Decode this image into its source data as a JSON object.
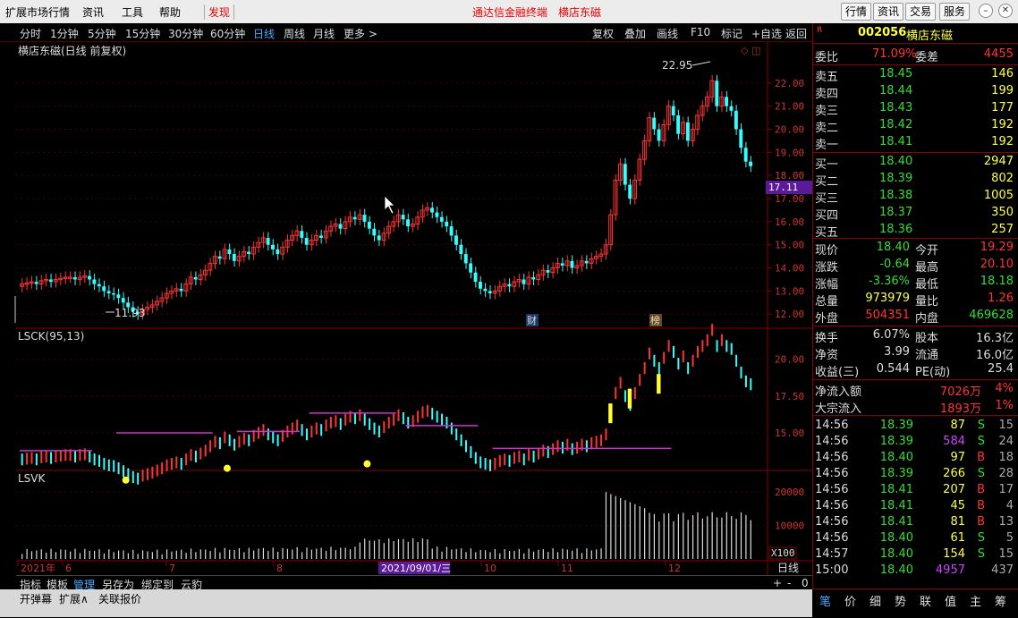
{
  "menu": {
    "items": [
      "扩展市场行情",
      "资讯",
      "工具",
      "帮助"
    ],
    "discover": "发现",
    "title": "通达信金融终端",
    "stock_title": "横店东磁",
    "right_buttons": [
      "行情",
      "资讯",
      "交易",
      "服务"
    ]
  },
  "toolbar": {
    "periods": [
      "分时",
      "1分钟",
      "5分钟",
      "15分钟",
      "30分钟",
      "60分钟",
      "日线",
      "周线",
      "月线",
      "更多 >"
    ],
    "active": "日线",
    "actions": [
      "复权",
      "叠加",
      "画线",
      "F10",
      "标记",
      "+自选",
      "返回"
    ]
  },
  "main_chart": {
    "title": "横店东磁(日线 前复权)",
    "price_label": "17.11",
    "high_label": "22.95",
    "low_label": "11.93",
    "y_ticks": [
      "22.00",
      "21.00",
      "20.00",
      "19.00",
      "18.00",
      "17.00",
      "16.00",
      "15.00",
      "14.00",
      "13.00",
      "12.00"
    ],
    "badges": [
      "财",
      "榜"
    ]
  },
  "lsck": {
    "title": "LSCK(95,13)",
    "y_ticks": [
      "20.00",
      "17.50",
      "15.00"
    ]
  },
  "lsvk": {
    "title": "LSVK",
    "y_ticks": [
      "20000",
      "10000"
    ],
    "unit": "X100"
  },
  "date_axis": {
    "labels": [
      "2021年",
      "6",
      "7",
      "8",
      "2021/09/01/三",
      "10",
      "11",
      "12"
    ],
    "period": "日线"
  },
  "indicator_tabs": [
    "指标",
    "模板",
    "管理",
    "另存为",
    "绑定到",
    "云豹"
  ],
  "bottom_tabs": [
    "开弹幕",
    "扩展∧",
    "关联报价"
  ],
  "quote": {
    "code": "002056",
    "name": "横店东磁",
    "weibi_label": "委比",
    "weibi": "71.09%",
    "weicha_label": "委差",
    "weicha": "4455",
    "asks": [
      {
        "l": "卖五",
        "p": "18.45",
        "v": "146"
      },
      {
        "l": "卖四",
        "p": "18.44",
        "v": "199"
      },
      {
        "l": "卖三",
        "p": "18.43",
        "v": "177"
      },
      {
        "l": "卖二",
        "p": "18.42",
        "v": "192"
      },
      {
        "l": "卖一",
        "p": "18.41",
        "v": "192"
      }
    ],
    "bids": [
      {
        "l": "买一",
        "p": "18.40",
        "v": "2947"
      },
      {
        "l": "买二",
        "p": "18.39",
        "v": "802"
      },
      {
        "l": "买三",
        "p": "18.38",
        "v": "1005"
      },
      {
        "l": "买四",
        "p": "18.37",
        "v": "350"
      },
      {
        "l": "买五",
        "p": "18.36",
        "v": "257"
      }
    ],
    "stats": [
      {
        "a": "现价",
        "av": "18.40",
        "ac": "#33dd33",
        "b": "今开",
        "bv": "19.29",
        "bc": "#ff3333"
      },
      {
        "a": "涨跌",
        "av": "-0.64",
        "ac": "#33dd33",
        "b": "最高",
        "bv": "20.10",
        "bc": "#ff3333"
      },
      {
        "a": "涨幅",
        "av": "-3.36%",
        "ac": "#33dd33",
        "b": "最低",
        "bv": "18.18",
        "bc": "#33dd33"
      },
      {
        "a": "总量",
        "av": "973979",
        "ac": "#ffff44",
        "b": "量比",
        "bv": "1.26",
        "bc": "#ff3333"
      },
      {
        "a": "外盘",
        "av": "504351",
        "ac": "#ff3333",
        "b": "内盘",
        "bv": "469628",
        "bc": "#33dd33"
      }
    ],
    "stats2": [
      {
        "a": "换手",
        "av": "6.07%",
        "b": "股本",
        "bv": "16.3亿"
      },
      {
        "a": "净资",
        "av": "3.99",
        "b": "流通",
        "bv": "16.0亿"
      },
      {
        "a": "收益(三)",
        "av": "0.544",
        "b": "PE(动)",
        "bv": "25.4"
      }
    ],
    "flow": [
      {
        "l": "净流入额",
        "v": "7026万",
        "p": "4%"
      },
      {
        "l": "大宗流入",
        "v": "1893万",
        "p": "1%"
      }
    ],
    "ticks": [
      {
        "t": "14:56",
        "p": "18.39",
        "pc": "#33dd33",
        "v": "87",
        "vc": "#ffff44",
        "s": "S",
        "n": "15"
      },
      {
        "t": "14:56",
        "p": "18.39",
        "pc": "#33dd33",
        "v": "584",
        "vc": "#cc44ff",
        "s": "S",
        "n": "24"
      },
      {
        "t": "14:56",
        "p": "18.40",
        "pc": "#33dd33",
        "v": "97",
        "vc": "#ffff44",
        "s": "B",
        "n": "18"
      },
      {
        "t": "14:56",
        "p": "18.39",
        "pc": "#33dd33",
        "v": "266",
        "vc": "#ffff44",
        "s": "S",
        "n": "28"
      },
      {
        "t": "14:56",
        "p": "18.41",
        "pc": "#33dd33",
        "v": "207",
        "vc": "#ffff44",
        "s": "B",
        "n": "17"
      },
      {
        "t": "14:56",
        "p": "18.41",
        "pc": "#33dd33",
        "v": "45",
        "vc": "#ffff44",
        "s": "B",
        "n": "4"
      },
      {
        "t": "14:56",
        "p": "18.41",
        "pc": "#33dd33",
        "v": "81",
        "vc": "#ffff44",
        "s": "B",
        "n": "13"
      },
      {
        "t": "14:56",
        "p": "18.40",
        "pc": "#33dd33",
        "v": "61",
        "vc": "#ffff44",
        "s": "S",
        "n": "5"
      },
      {
        "t": "14:57",
        "p": "18.40",
        "pc": "#33dd33",
        "v": "154",
        "vc": "#ffff44",
        "s": "S",
        "n": "15"
      },
      {
        "t": "15:00",
        "p": "18.40",
        "pc": "#33dd33",
        "v": "4957",
        "vc": "#cc44ff",
        "s": "",
        "n": "437"
      }
    ],
    "right_tabs": [
      "笔",
      "价",
      "细",
      "势",
      "联",
      "值",
      "主",
      "筹"
    ]
  },
  "chart_data": {
    "type": "candlestick",
    "title": "横店东磁(日线 前复权)",
    "ylim": [
      11.7,
      23.0
    ],
    "close": [
      13.3,
      13.35,
      13.4,
      13.3,
      13.45,
      13.5,
      13.4,
      13.5,
      13.55,
      13.6,
      13.6,
      13.5,
      13.6,
      13.65,
      13.5,
      13.3,
      13.2,
      13.0,
      12.9,
      12.85,
      12.7,
      12.5,
      12.3,
      12.1,
      12.0,
      12.2,
      12.3,
      12.4,
      12.55,
      12.7,
      12.9,
      13.0,
      13.1,
      13.0,
      13.3,
      13.6,
      13.5,
      13.7,
      13.9,
      14.2,
      14.5,
      14.4,
      14.8,
      14.6,
      14.3,
      14.5,
      14.7,
      14.6,
      14.9,
      15.1,
      15.3,
      15.0,
      14.8,
      14.6,
      14.9,
      15.2,
      15.4,
      15.6,
      15.3,
      15.0,
      15.2,
      15.4,
      15.3,
      15.6,
      15.8,
      15.9,
      15.7,
      16.0,
      16.2,
      16.1,
      16.3,
      16.0,
      15.7,
      15.4,
      15.2,
      15.5,
      15.8,
      16.0,
      16.3,
      16.1,
      15.8,
      15.9,
      16.2,
      16.5,
      16.6,
      16.4,
      16.2,
      16.0,
      15.8,
      15.4,
      15.0,
      14.6,
      14.2,
      13.8,
      13.4,
      13.1,
      13.0,
      12.9,
      13.0,
      13.2,
      13.3,
      13.2,
      13.4,
      13.5,
      13.3,
      13.6,
      13.5,
      13.7,
      13.9,
      13.8,
      14.0,
      14.2,
      14.1,
      14.3,
      14.0,
      14.1,
      14.3,
      14.2,
      14.4,
      14.5,
      14.6,
      15.0,
      16.3,
      17.8,
      18.5,
      17.6,
      17.0,
      17.8,
      18.7,
      19.5,
      20.5,
      20.0,
      19.5,
      20.2,
      21.0,
      20.6,
      19.8,
      20.3,
      19.5,
      20.0,
      20.6,
      21.0,
      21.4,
      22.1,
      21.0,
      21.4,
      21.0,
      20.8,
      20.0,
      19.2,
      18.6,
      18.4
    ],
    "ind_line_values": [
      13.8,
      15.0,
      15.1,
      16.35,
      15.5,
      13.95,
      13.75
    ],
    "volume_ylim": [
      0,
      23000
    ]
  }
}
